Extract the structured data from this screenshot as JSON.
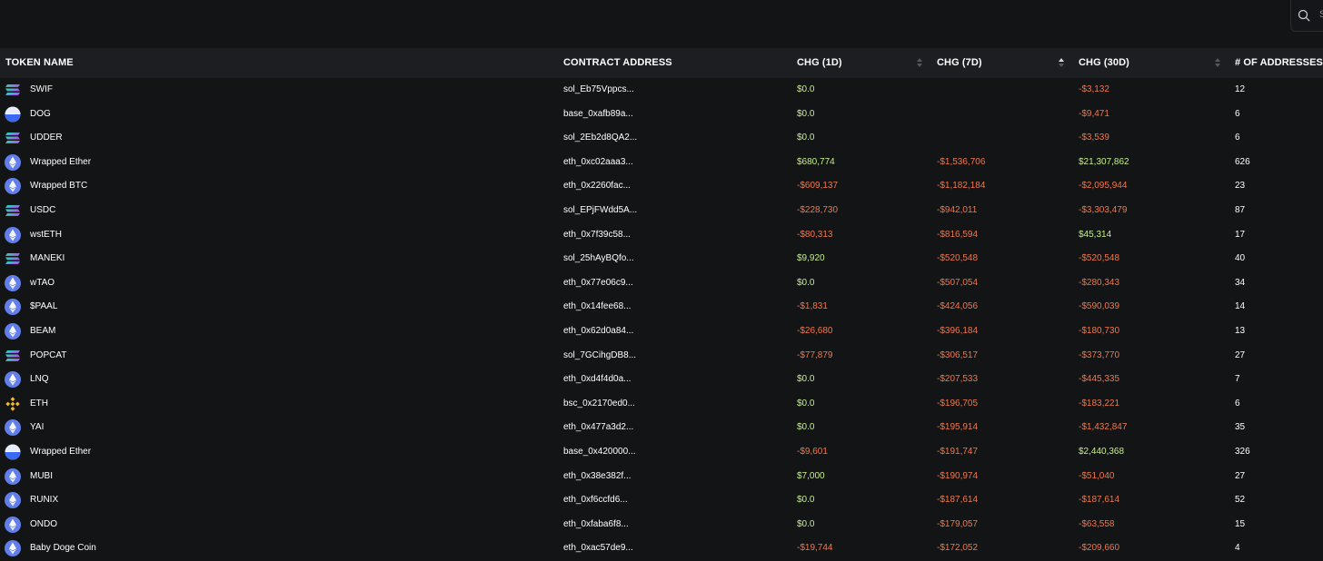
{
  "search": {
    "placeholder": "S"
  },
  "table": {
    "columns": {
      "token_name": "TOKEN NAME",
      "contract_address": "CONTRACT ADDRESS",
      "chg_1d": "CHG (1D)",
      "chg_7d": "CHG (7D)",
      "chg_30d": "CHG (30D)",
      "num_addresses": "# OF ADDRESSES"
    },
    "sort": {
      "column": "chg_7d",
      "direction": "asc"
    },
    "rows": [
      {
        "icon": "solana-icon",
        "name": "SWIF",
        "address": "sol_Eb75Vppcs...",
        "chg_1d": "$0.0",
        "chg_7d": "",
        "chg_30d": "-$3,132",
        "count": "12"
      },
      {
        "icon": "base-icon",
        "name": "DOG",
        "address": "base_0xafb89a...",
        "chg_1d": "$0.0",
        "chg_7d": "",
        "chg_30d": "-$9,471",
        "count": "6"
      },
      {
        "icon": "solana-icon",
        "name": "UDDER",
        "address": "sol_2Eb2d8QA2...",
        "chg_1d": "$0.0",
        "chg_7d": "",
        "chg_30d": "-$3,539",
        "count": "6"
      },
      {
        "icon": "ethereum-icon",
        "name": "Wrapped Ether",
        "address": "eth_0xc02aaa3...",
        "chg_1d": "$680,774",
        "chg_7d": "-$1,536,706",
        "chg_30d": "$21,307,862",
        "count": "626"
      },
      {
        "icon": "ethereum-icon",
        "name": "Wrapped BTC",
        "address": "eth_0x2260fac...",
        "chg_1d": "-$609,137",
        "chg_7d": "-$1,182,184",
        "chg_30d": "-$2,095,944",
        "count": "23"
      },
      {
        "icon": "solana-icon",
        "name": "USDC",
        "address": "sol_EPjFWdd5A...",
        "chg_1d": "-$228,730",
        "chg_7d": "-$942,011",
        "chg_30d": "-$3,303,479",
        "count": "87"
      },
      {
        "icon": "ethereum-icon",
        "name": "wstETH",
        "address": "eth_0x7f39c58...",
        "chg_1d": "-$80,313",
        "chg_7d": "-$816,594",
        "chg_30d": "$45,314",
        "count": "17"
      },
      {
        "icon": "solana-icon",
        "name": "MANEKI",
        "address": "sol_25hAyBQfo...",
        "chg_1d": "$9,920",
        "chg_7d": "-$520,548",
        "chg_30d": "-$520,548",
        "count": "40"
      },
      {
        "icon": "ethereum-icon",
        "name": "wTAO",
        "address": "eth_0x77e06c9...",
        "chg_1d": "$0.0",
        "chg_7d": "-$507,054",
        "chg_30d": "-$280,343",
        "count": "34"
      },
      {
        "icon": "ethereum-icon",
        "name": "$PAAL",
        "address": "eth_0x14fee68...",
        "chg_1d": "-$1,831",
        "chg_7d": "-$424,056",
        "chg_30d": "-$590,039",
        "count": "14"
      },
      {
        "icon": "ethereum-icon",
        "name": "BEAM",
        "address": "eth_0x62d0a84...",
        "chg_1d": "-$26,680",
        "chg_7d": "-$396,184",
        "chg_30d": "-$180,730",
        "count": "13"
      },
      {
        "icon": "solana-icon",
        "name": "POPCAT",
        "address": "sol_7GCihgDB8...",
        "chg_1d": "-$77,879",
        "chg_7d": "-$306,517",
        "chg_30d": "-$373,770",
        "count": "27"
      },
      {
        "icon": "ethereum-icon",
        "name": "LNQ",
        "address": "eth_0xd4f4d0a...",
        "chg_1d": "$0.0",
        "chg_7d": "-$207,533",
        "chg_30d": "-$445,335",
        "count": "7"
      },
      {
        "icon": "bnb-icon",
        "name": "ETH",
        "address": "bsc_0x2170ed0...",
        "chg_1d": "$0.0",
        "chg_7d": "-$196,705",
        "chg_30d": "-$183,221",
        "count": "6"
      },
      {
        "icon": "ethereum-icon",
        "name": "YAI",
        "address": "eth_0x477a3d2...",
        "chg_1d": "$0.0",
        "chg_7d": "-$195,914",
        "chg_30d": "-$1,432,847",
        "count": "35"
      },
      {
        "icon": "base-icon",
        "name": "Wrapped Ether",
        "address": "base_0x420000...",
        "chg_1d": "-$9,601",
        "chg_7d": "-$191,747",
        "chg_30d": "$2,440,368",
        "count": "326"
      },
      {
        "icon": "ethereum-icon",
        "name": "MUBI",
        "address": "eth_0x38e382f...",
        "chg_1d": "$7,000",
        "chg_7d": "-$190,974",
        "chg_30d": "-$51,040",
        "count": "27"
      },
      {
        "icon": "ethereum-icon",
        "name": "RUNIX",
        "address": "eth_0xf6ccfd6...",
        "chg_1d": "$0.0",
        "chg_7d": "-$187,614",
        "chg_30d": "-$187,614",
        "count": "52"
      },
      {
        "icon": "ethereum-icon",
        "name": "ONDO",
        "address": "eth_0xfaba6f8...",
        "chg_1d": "$0.0",
        "chg_7d": "-$179,057",
        "chg_30d": "-$63,558",
        "count": "15"
      },
      {
        "icon": "ethereum-icon",
        "name": "Baby Doge Coin",
        "address": "eth_0xac57de9...",
        "chg_1d": "-$19,744",
        "chg_7d": "-$172,052",
        "chg_30d": "-$209,660",
        "count": "4"
      }
    ]
  }
}
